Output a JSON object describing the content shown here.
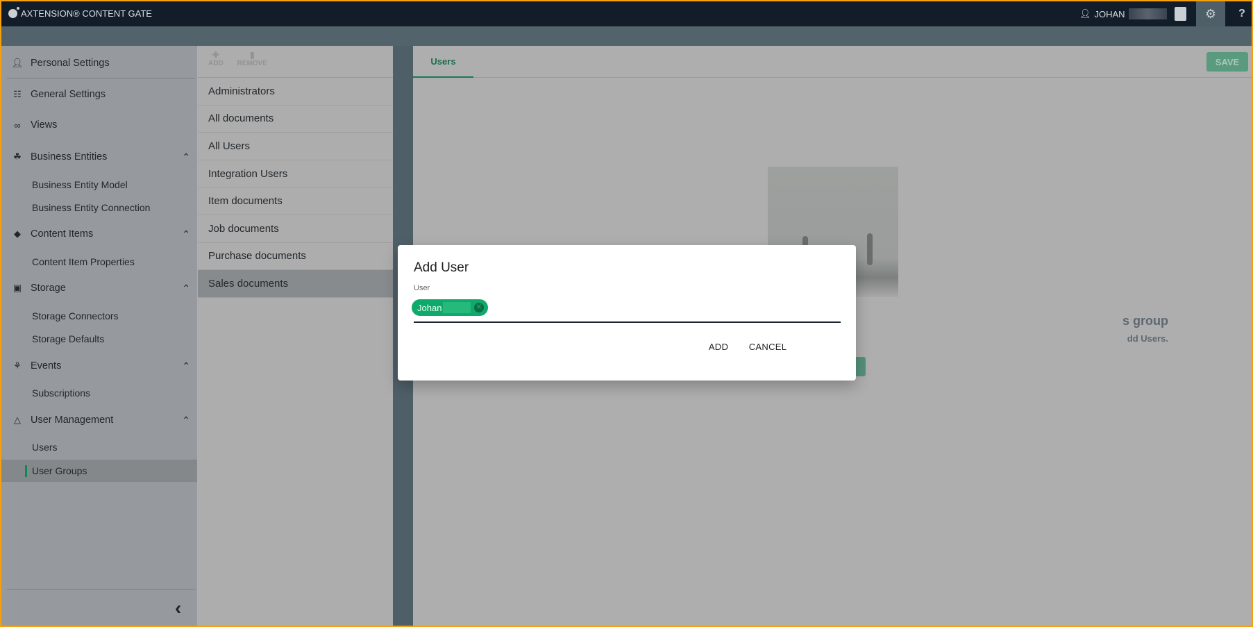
{
  "app": {
    "title": "AXTENSION® CONTENT GATE",
    "user": "JOHAN",
    "icons": [
      "logo-icon",
      "user-icon",
      "clipboard-icon",
      "gear-icon",
      "help-icon"
    ],
    "help_label": "?"
  },
  "sidebar": {
    "items": [
      {
        "label": "Personal Settings",
        "icon": "person-icon",
        "type": "main"
      },
      {
        "label": "General Settings",
        "icon": "sliders-icon",
        "type": "main"
      },
      {
        "label": "Views",
        "icon": "glasses-icon",
        "type": "main"
      },
      {
        "label": "Business Entities",
        "icon": "hierarchy-icon",
        "type": "main",
        "expanded": true
      },
      {
        "label": "Business Entity Model",
        "type": "sub"
      },
      {
        "label": "Business Entity Connection",
        "type": "sub"
      },
      {
        "label": "Content Items",
        "icon": "tag-icon",
        "type": "main",
        "expanded": true
      },
      {
        "label": "Content Item Properties",
        "type": "sub"
      },
      {
        "label": "Storage",
        "icon": "archive-icon",
        "type": "main",
        "expanded": true
      },
      {
        "label": "Storage Connectors",
        "type": "sub"
      },
      {
        "label": "Storage Defaults",
        "type": "sub"
      },
      {
        "label": "Events",
        "icon": "webhook-icon",
        "type": "main",
        "expanded": true
      },
      {
        "label": "Subscriptions",
        "type": "sub"
      },
      {
        "label": "User Management",
        "icon": "org-chart-icon",
        "type": "main",
        "expanded": true
      },
      {
        "label": "Users",
        "type": "sub"
      },
      {
        "label": "User Groups",
        "type": "sub",
        "active": true
      }
    ]
  },
  "groups": {
    "toolbar": {
      "add": "ADD",
      "remove": "REMOVE"
    },
    "items": [
      "Administrators",
      "All documents",
      "All Users",
      "Integration Users",
      "Item documents",
      "Job documents",
      "Purchase documents",
      "Sales documents"
    ],
    "selected": "Sales documents"
  },
  "main": {
    "tab": "Users",
    "save": "SAVE",
    "empty_title_fragment": "s group",
    "empty_sub_fragment": "dd Users."
  },
  "dialog": {
    "title": "Add User",
    "field_label": "User",
    "chip": "Johan",
    "add": "ADD",
    "cancel": "CANCEL"
  },
  "colors": {
    "accent": "#10a96c",
    "topbar": "#131d29",
    "active_marker": "#0f8a55"
  }
}
